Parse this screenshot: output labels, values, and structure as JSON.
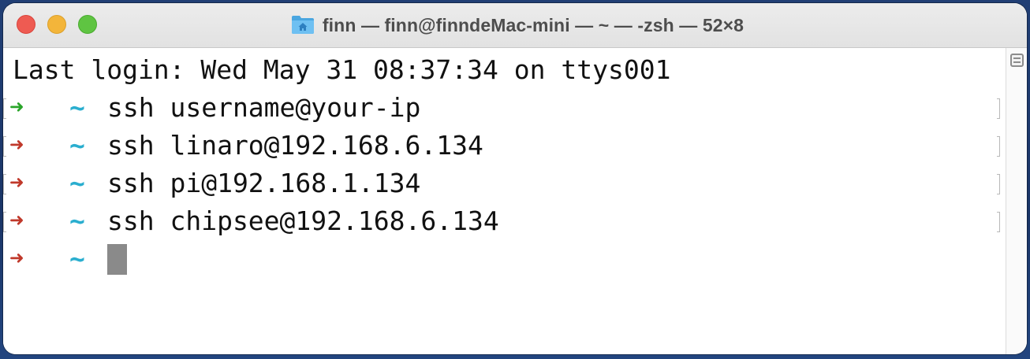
{
  "window": {
    "title": "finn — finn@finndeMac-mini — ~ — -zsh — 52×8",
    "title_icon": "home-folder-icon"
  },
  "colors": {
    "arrow_success": "#2aa52a",
    "arrow_error": "#c0392b",
    "tilde": "#2aaecf",
    "cursor": "#8a8a8a"
  },
  "terminal": {
    "last_login": "Last login: Wed May 31 08:37:34 on ttys001",
    "prompt_arrow": "➜",
    "prompt_dir": "~",
    "history": [
      {
        "command": "ssh username@your-ip",
        "status": "success"
      },
      {
        "command": "ssh linaro@192.168.6.134",
        "status": "error"
      },
      {
        "command": "ssh pi@192.168.1.134",
        "status": "error"
      },
      {
        "command": "ssh chipsee@192.168.6.134",
        "status": "error"
      }
    ],
    "current_prompt": {
      "status": "error",
      "input": ""
    }
  }
}
